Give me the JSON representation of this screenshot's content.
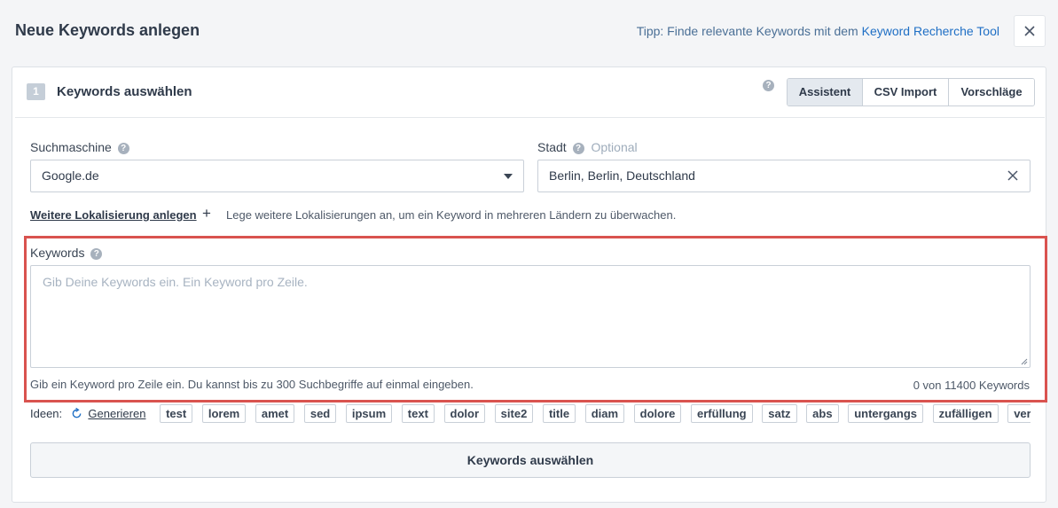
{
  "modal": {
    "title": "Neue Keywords anlegen",
    "tip_prefix": "Tipp: Finde relevante Keywords mit dem",
    "tip_link": "Keyword Recherche Tool",
    "close_icon": "close-icon"
  },
  "step": {
    "number": "1",
    "title": "Keywords auswählen",
    "tabs": [
      "Assistent",
      "CSV Import",
      "Vorschläge"
    ],
    "active_tab": "Assistent"
  },
  "search_engine": {
    "label": "Suchmaschine",
    "value": "Google.de"
  },
  "city": {
    "label": "Stadt",
    "optional": "Optional",
    "value": "Berlin,  Berlin,  Deutschland"
  },
  "localization": {
    "link": "Weitere Lokalisierung anlegen",
    "plus": "+",
    "hint": "Lege weitere Lokalisierungen an, um ein Keyword in mehreren Ländern zu überwachen."
  },
  "keywords": {
    "label": "Keywords",
    "placeholder": "Gib Deine Keywords ein. Ein Keyword pro Zeile.",
    "hint": "Gib ein Keyword pro Zeile ein. Du kannst bis zu 300 Suchbegriffe auf einmal eingeben.",
    "count": "0 von 11400 Keywords"
  },
  "ideas": {
    "label": "Ideen:",
    "generate": "Generieren",
    "chips": [
      "test",
      "lorem",
      "amet",
      "sed",
      "ipsum",
      "text",
      "dolor",
      "site2",
      "title",
      "diam",
      "dolore",
      "erfüllung",
      "satz",
      "abs",
      "untergangs",
      "zufälligen",
      "verkäufe"
    ]
  },
  "submit": {
    "label": "Keywords auswählen"
  },
  "colors": {
    "highlight_border": "#d9534f",
    "link": "#1f6fc5"
  }
}
